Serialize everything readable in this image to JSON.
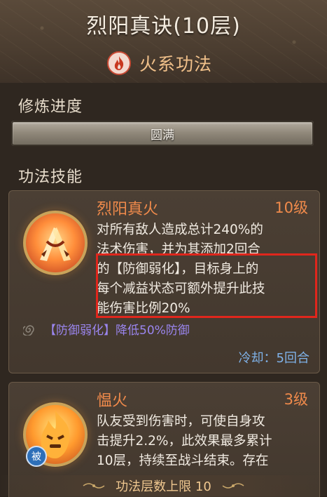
{
  "header": {
    "title": "烈阳真诀(10层)",
    "element_icon": "fire-icon",
    "element_label": "火系功法"
  },
  "cultivation": {
    "section_title": "修炼进度",
    "progress_label": "圆满",
    "progress": 1.0
  },
  "skills_section": {
    "title": "功法技能",
    "skills": [
      {
        "name": "烈阳真火",
        "level": "10级",
        "icon": "fire-fists-icon",
        "desc_lines": [
          "对所有敌人造成总计240%的",
          "法术伤害，并为其添加2回合",
          "的【防御弱化】，目标身上的",
          "每个减益状态可额外提升此技",
          "能伤害比例20%"
        ],
        "effect_icon": "swirl-icon",
        "effect_text": "【防御弱化】降低50%防御",
        "cooldown": "冷却：5回合"
      },
      {
        "name": "愠火",
        "level": "3级",
        "icon": "angry-fire-icon",
        "passive_tag": "被",
        "desc_lines": [
          "队友受到伤害时，可使自身攻",
          "击提升2.2%，此效果最多累计",
          "10层，持续至战斗结束。存在"
        ]
      }
    ]
  },
  "footer": {
    "label": "功法层数上限 10"
  },
  "colors": {
    "accent_orange": "#f08a4b",
    "effect_purple": "#9b86f0",
    "cooldown_blue": "#7fb2e8",
    "highlight_red": "#e0261c"
  }
}
